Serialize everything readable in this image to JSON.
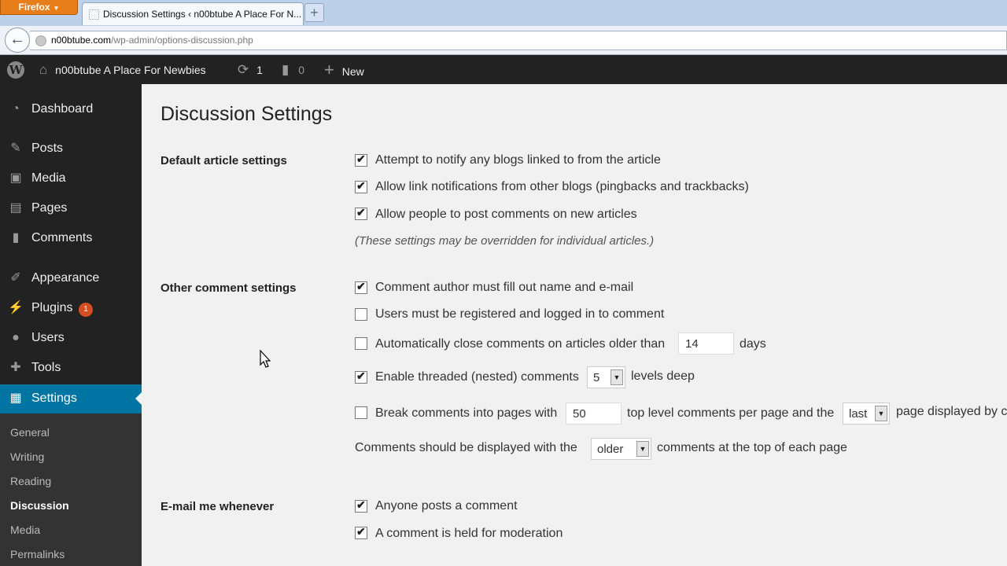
{
  "browser": {
    "menu_button": "Firefox",
    "tab_title": "Discussion Settings ‹ n00btube A Place For N...",
    "new_tab": "+",
    "back": "←",
    "url_host": "n00btube.com",
    "url_path": "/wp-admin/options-discussion.php"
  },
  "adminbar": {
    "wp_logo": "W",
    "site_icon": "home-icon",
    "site_name": "n00btube A Place For Newbies",
    "updates_icon": "⟳",
    "updates_count": "1",
    "comments_icon": "▮",
    "comments_count": "0",
    "new_icon": "+",
    "new_label": "New"
  },
  "sidebar": {
    "items": [
      {
        "label": "Dashboard",
        "icon": "◔",
        "icon_name": "dashboard"
      },
      {
        "label": "Posts",
        "icon": "✎",
        "icon_name": "pin"
      },
      {
        "label": "Media",
        "icon": "▣",
        "icon_name": "media"
      },
      {
        "label": "Pages",
        "icon": "▤",
        "icon_name": "page"
      },
      {
        "label": "Comments",
        "icon": "▮",
        "icon_name": "comment"
      },
      {
        "label": "Appearance",
        "icon": "✐",
        "icon_name": "brush"
      },
      {
        "label": "Plugins",
        "icon": "⚡",
        "icon_name": "plug",
        "badge": "1"
      },
      {
        "label": "Users",
        "icon": "●",
        "icon_name": "user"
      },
      {
        "label": "Tools",
        "icon": "✚",
        "icon_name": "wrench"
      },
      {
        "label": "Settings",
        "icon": "▦",
        "icon_name": "settings"
      }
    ],
    "submenu": [
      "General",
      "Writing",
      "Reading",
      "Discussion",
      "Media",
      "Permalinks"
    ]
  },
  "main": {
    "title": "Discussion Settings",
    "default_article": {
      "heading": "Default article settings",
      "options": [
        {
          "label": "Attempt to notify any blogs linked to from the article",
          "checked": true
        },
        {
          "label": "Allow link notifications from other blogs (pingbacks and trackbacks)",
          "checked": true
        },
        {
          "label": "Allow people to post comments on new articles",
          "checked": true
        }
      ],
      "note": "(These settings may be overridden for individual articles.)"
    },
    "other_comment": {
      "heading": "Other comment settings",
      "author_fill": {
        "label": "Comment author must fill out name and e-mail",
        "checked": true
      },
      "registered": {
        "label": "Users must be registered and logged in to comment",
        "checked": false
      },
      "auto_close": {
        "label": "Automatically close comments on articles older than",
        "checked": false,
        "value": "14",
        "suffix": "days"
      },
      "threaded": {
        "label": "Enable threaded (nested) comments",
        "checked": true,
        "value": "5",
        "suffix": "levels deep"
      },
      "paged": {
        "label": "Break comments into pages with",
        "checked": false,
        "value": "50",
        "middle": "top level comments per page and the",
        "select": "last",
        "suffix": "page displayed by c"
      },
      "order": {
        "prefix": "Comments should be displayed with the",
        "select": "older",
        "suffix": "comments at the top of each page"
      }
    },
    "email": {
      "heading": "E-mail me whenever",
      "options": [
        {
          "label": "Anyone posts a comment",
          "checked": true
        },
        {
          "label": "A comment is held for moderation",
          "checked": true
        }
      ]
    }
  }
}
